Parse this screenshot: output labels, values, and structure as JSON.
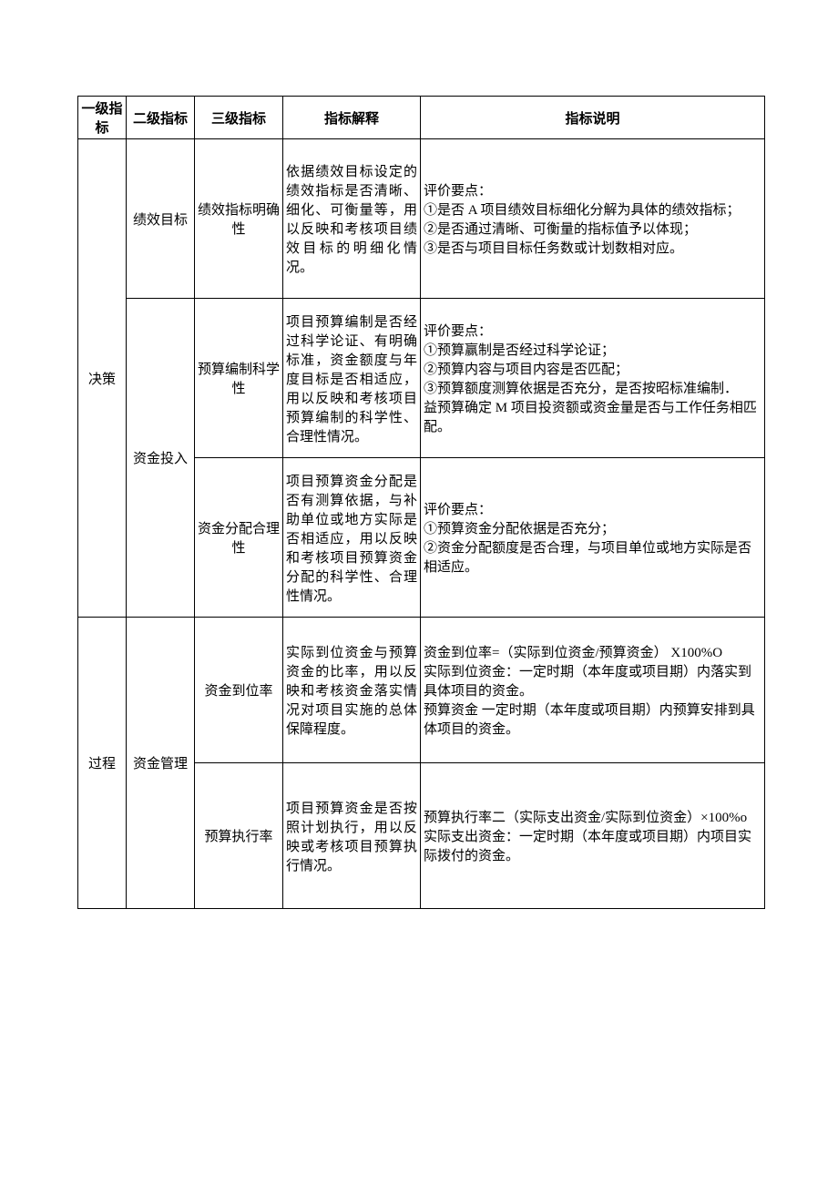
{
  "headers": {
    "col1": "一级指标",
    "col2": "二级指标",
    "col3": "三级指标",
    "col4": "指标解释",
    "col5": "指标说明"
  },
  "rows": [
    {
      "lvl1": "决策",
      "lvl1_span": 3,
      "lvl2": "绩效目标",
      "lvl2_span": 1,
      "lvl3": "绩效指标明确性",
      "explain": "依据绩效目标设定的绩效指标是否清晰、细化、可衡量等，用以反映和考核项目绩效目标的明细化情况。",
      "desc": "评价要点：\n①是否 A 项目绩效目标细化分解为具体的绩效指标；\n②是否通过清晰、可衡量的指标值予以体现；\n③是否与项目目标任务数或计划数相对应。"
    },
    {
      "lvl2": "资金投入",
      "lvl2_span": 2,
      "lvl3": "预算编制科学性",
      "explain": "项目预算编制是否经过科学论证、有明确标准，资金额度与年度目标是否相适应，用以反映和考核项目预算编制的科学性、合理性情况。",
      "desc": "评价要点：\n①预算赢制是否经过科学论证；\n②预算内容与项目内容是否匹配；\n③预算额度测算依据是否充分，是否按昭标准编制．\n益预算确定 M 项目投资额或资金量是否与工作任务相匹配。"
    },
    {
      "lvl3": "资金分配合理性",
      "explain": "项目预算资金分配是否有测算依据，与补助单位或地方实际是否相适应，用以反映和考核项目预算资金分配的科学性、合理性情况。",
      "desc": "评价要点：\n①预算资金分配依据是否充分；\n②资金分配额度是否合理，与项目单位或地方实际是否相适应。"
    },
    {
      "lvl1": "过程",
      "lvl1_span": 2,
      "lvl2": "资金管理",
      "lvl2_span": 2,
      "lvl3": "资金到位率",
      "explain": "实际到位资金与预算资金的比率，用以反映和考核资金落实情况对项目实施的总体保障程度。",
      "desc": "资金到位率=（实际到位资金/预算资金） X100%O\n实际到位资金：一定时期（本年度或项目期）内落实到具体项目的资金。\n预算资金 一定时期（本年度或项目期）内预算安排到具体项目的资金。"
    },
    {
      "lvl3": "预算执行率",
      "explain": "项目预算资金是否按照计划执行，用以反映或考核项目预算执行情况。",
      "desc": "预算执行率二（实际支出资金/实际到位资金）×100%o\n实际支出资金：一定时期（本年度或项目期）内项目实际拨付的资金。"
    }
  ]
}
